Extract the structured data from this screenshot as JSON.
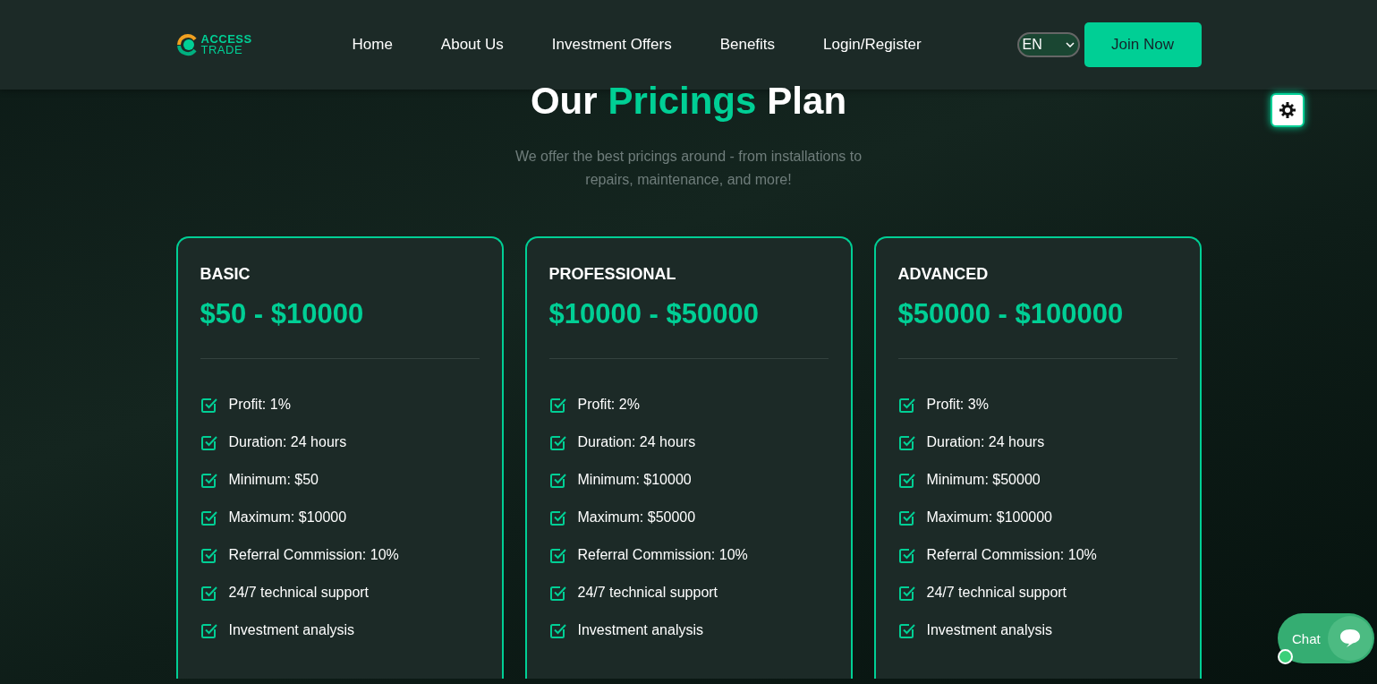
{
  "header": {
    "logo": {
      "line_1": "ACCESS",
      "line_2": "TRADE"
    },
    "nav": [
      {
        "label": "Home"
      },
      {
        "label": "About Us"
      },
      {
        "label": "Investment Offers"
      },
      {
        "label": "Benefits"
      },
      {
        "label": "Login/Register"
      }
    ],
    "language": {
      "value": "EN"
    },
    "cta": "Join Now"
  },
  "section": {
    "title": [
      {
        "text": "Our",
        "highlight": false
      },
      {
        "text": "Pricings",
        "highlight": true
      },
      {
        "text": "Plan",
        "highlight": false
      }
    ],
    "subtitle": "We offer the best pricings around - from installations to repairs, maintenance, and more!"
  },
  "plans": [
    {
      "name": "BASIC",
      "price": "$50 - $10000",
      "features": [
        "Profit: 1%",
        "Duration: 24 hours",
        "Minimum: $50",
        "Maximum: $10000",
        "Referral Commission: 10%",
        "24/7 technical support",
        "Investment analysis"
      ]
    },
    {
      "name": "PROFESSIONAL",
      "price": "$10000 - $50000",
      "features": [
        "Profit: 2%",
        "Duration: 24 hours",
        "Minimum: $10000",
        "Maximum: $50000",
        "Referral Commission: 10%",
        "24/7 technical support",
        "Investment analysis"
      ]
    },
    {
      "name": "ADVANCED",
      "price": "$50000 - $100000",
      "features": [
        "Profit: 3%",
        "Duration: 24 hours",
        "Minimum: $50000",
        "Maximum: $100000",
        "Referral Commission: 10%",
        "24/7 technical support",
        "Investment analysis"
      ]
    }
  ],
  "chat": {
    "label": "Chat"
  }
}
